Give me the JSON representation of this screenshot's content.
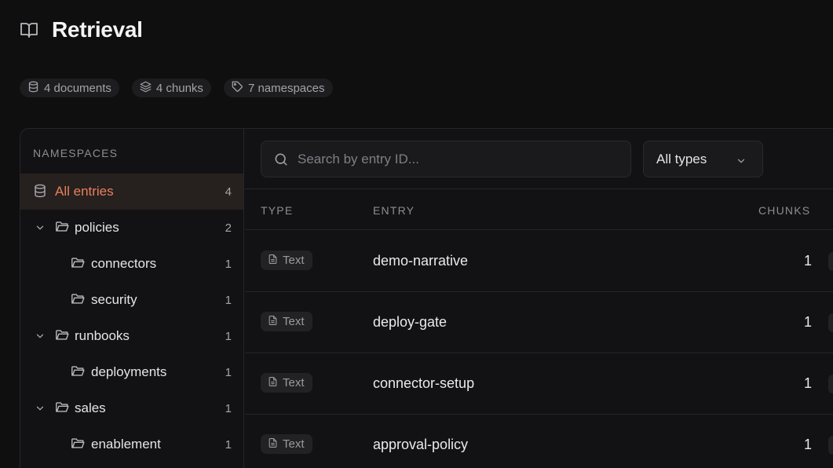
{
  "header": {
    "title": "Retrieval",
    "icon": "book-open-icon"
  },
  "stats": [
    {
      "icon": "database-icon",
      "label": "4 documents"
    },
    {
      "icon": "layers-icon",
      "label": "4 chunks"
    },
    {
      "icon": "tag-icon",
      "label": "7 namespaces"
    }
  ],
  "sidebar": {
    "heading": "NAMESPACES",
    "items": [
      {
        "label": "All entries",
        "count": "4"
      },
      {
        "label": "policies",
        "count": "2"
      },
      {
        "label": "connectors",
        "count": "1"
      },
      {
        "label": "security",
        "count": "1"
      },
      {
        "label": "runbooks",
        "count": "1"
      },
      {
        "label": "deployments",
        "count": "1"
      },
      {
        "label": "sales",
        "count": "1"
      },
      {
        "label": "enablement",
        "count": "1"
      }
    ]
  },
  "toolbar": {
    "search_placeholder": "Search by entry ID...",
    "type_filter": "All types"
  },
  "table": {
    "columns": {
      "type": "TYPE",
      "entry": "ENTRY",
      "chunks": "CHUNKS"
    },
    "rows": [
      {
        "type": "Text",
        "entry": "demo-narrative",
        "chunks": "1"
      },
      {
        "type": "Text",
        "entry": "deploy-gate",
        "chunks": "1"
      },
      {
        "type": "Text",
        "entry": "connector-setup",
        "chunks": "1"
      },
      {
        "type": "Text",
        "entry": "approval-policy",
        "chunks": "1"
      }
    ]
  },
  "colors": {
    "background": "#0f0f10",
    "accent": "#e8805e",
    "active_bg": "#26201e",
    "border": "#26262a"
  }
}
